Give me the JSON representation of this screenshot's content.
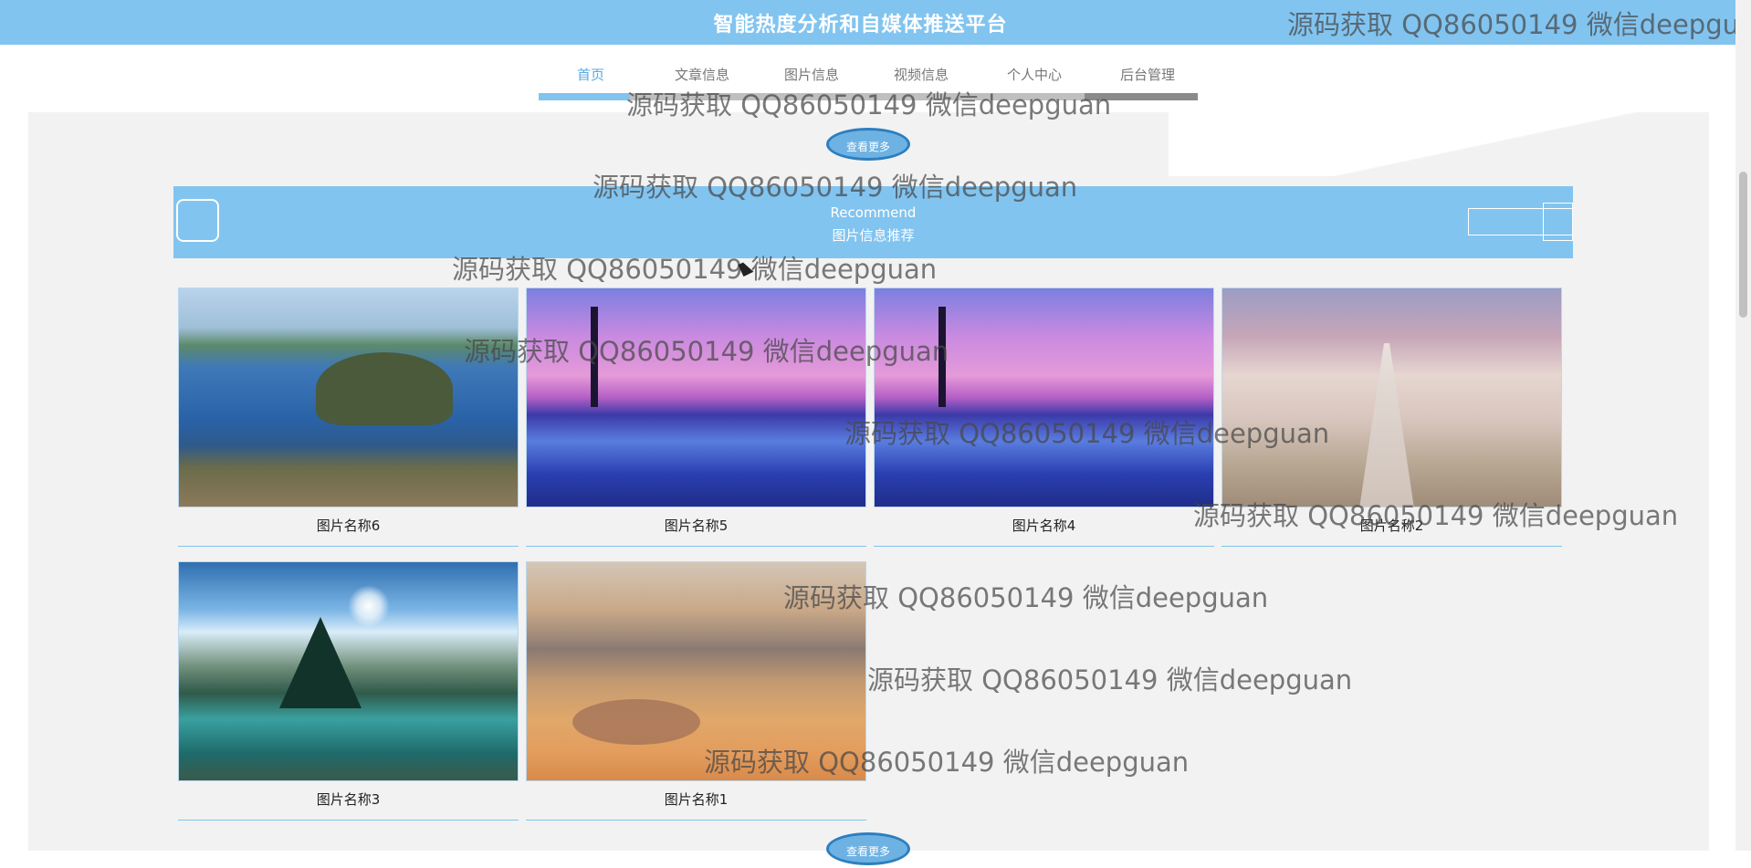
{
  "header": {
    "site_title": "智能热度分析和自媒体推送平台"
  },
  "nav": {
    "items": [
      {
        "label": "首页",
        "active": true
      },
      {
        "label": "文章信息",
        "active": false
      },
      {
        "label": "图片信息",
        "active": false
      },
      {
        "label": "视频信息",
        "active": false
      },
      {
        "label": "个人中心",
        "active": false
      },
      {
        "label": "后台管理",
        "active": false
      }
    ]
  },
  "section": {
    "more_label": "查看更多",
    "more_label_bottom": "查看更多",
    "banner_en": "Recommend",
    "banner_cn": "图片信息推荐"
  },
  "gallery": {
    "items": [
      {
        "title": "图片名称6",
        "image": "lake-island-photo"
      },
      {
        "title": "图片名称5",
        "image": "palm-pool-sunset-photo"
      },
      {
        "title": "图片名称4",
        "image": "palm-pool-sunset-photo"
      },
      {
        "title": "图片名称2",
        "image": "flower-field-rainbow-photo"
      },
      {
        "title": "图片名称3",
        "image": "mountain-lake-photo"
      },
      {
        "title": "图片名称1",
        "image": "cloud-sky-photo"
      }
    ]
  },
  "watermark": {
    "text": "源码获取 QQ86050149 微信deepguan"
  },
  "colors": {
    "header_bg": "#82c4f0",
    "accent_blue": "#5aa9e0",
    "content_bg": "#f2f2f2"
  }
}
